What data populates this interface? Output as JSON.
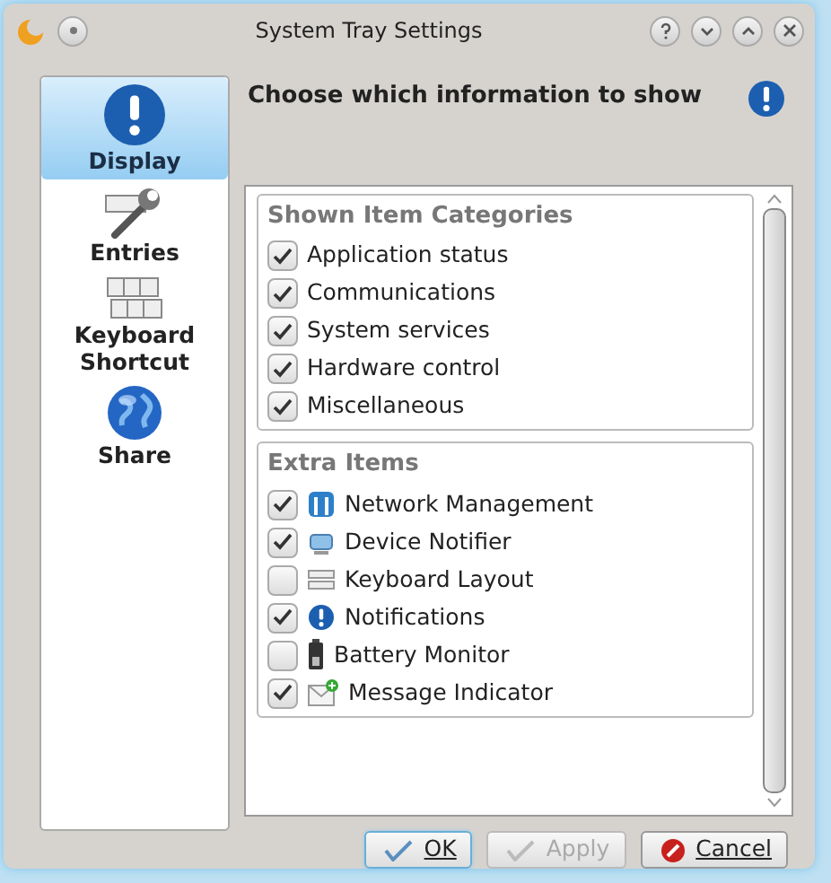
{
  "window": {
    "title": "System Tray Settings"
  },
  "sidebar": {
    "items": [
      {
        "label": "Display",
        "kind": "info",
        "selected": true
      },
      {
        "label": "Entries",
        "kind": "wrench",
        "selected": false
      },
      {
        "label": "Keyboard Shortcut",
        "kind": "keyboard",
        "selected": false
      },
      {
        "label": "Share",
        "kind": "globe",
        "selected": false
      }
    ]
  },
  "page": {
    "heading": "Choose which information to show"
  },
  "groups": [
    {
      "title": "Shown Item Categories",
      "items": [
        {
          "label": "Application status",
          "checked": true
        },
        {
          "label": "Communications",
          "checked": true
        },
        {
          "label": "System services",
          "checked": true
        },
        {
          "label": "Hardware control",
          "checked": true
        },
        {
          "label": "Miscellaneous",
          "checked": true
        }
      ]
    },
    {
      "title": "Extra Items",
      "items": [
        {
          "label": "Network Management",
          "checked": true,
          "kind": "network"
        },
        {
          "label": "Device Notifier",
          "checked": true,
          "kind": "device"
        },
        {
          "label": "Keyboard Layout",
          "checked": false,
          "kind": "keyboard"
        },
        {
          "label": "Notifications",
          "checked": true,
          "kind": "info"
        },
        {
          "label": "Battery Monitor",
          "checked": false,
          "kind": "battery"
        },
        {
          "label": "Message Indicator",
          "checked": true,
          "kind": "message"
        }
      ]
    }
  ],
  "buttons": [
    {
      "label": "OK",
      "kind": "ok",
      "disabled": false
    },
    {
      "label": "Apply",
      "kind": "apply",
      "disabled": true
    },
    {
      "label": "Cancel",
      "kind": "cancel",
      "disabled": false
    }
  ]
}
